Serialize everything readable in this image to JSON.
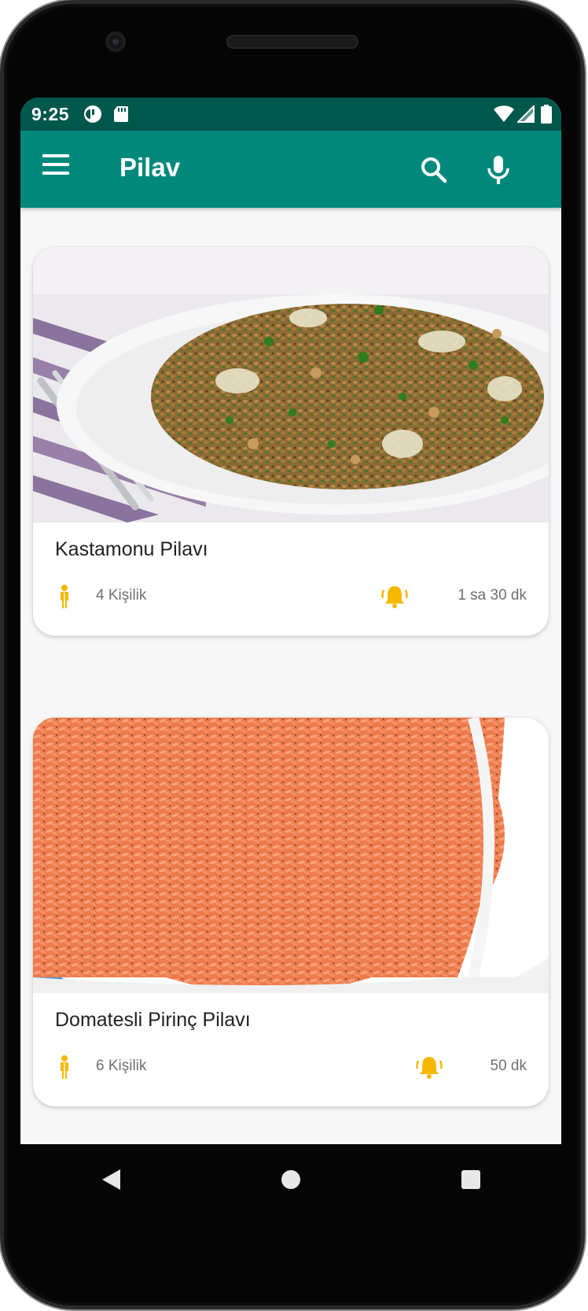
{
  "status_bar": {
    "time": "9:25",
    "left_icons": [
      "camera-app-icon",
      "sd-card-icon"
    ],
    "right_icons": [
      "wifi-icon",
      "signal-icon",
      "battery-icon"
    ]
  },
  "app_bar": {
    "title": "Pilav",
    "background": "#00897b",
    "status_background": "#00574b",
    "actions": [
      "search-icon",
      "microphone-icon"
    ]
  },
  "recipes": [
    {
      "name": "Kastamonu Pilavı",
      "servings": "4 Kişilik",
      "duration": "1 sa 30 dk",
      "image": "bulgur-pilaf-photo"
    },
    {
      "name": "Domatesli Pirinç Pilavı",
      "servings": "6 Kişilik",
      "duration": "50 dk",
      "image": "tomato-rice-pilaf-photo"
    }
  ],
  "accent_color": "#f5b800",
  "nav_bar": [
    "back-icon",
    "home-icon",
    "recents-icon"
  ]
}
